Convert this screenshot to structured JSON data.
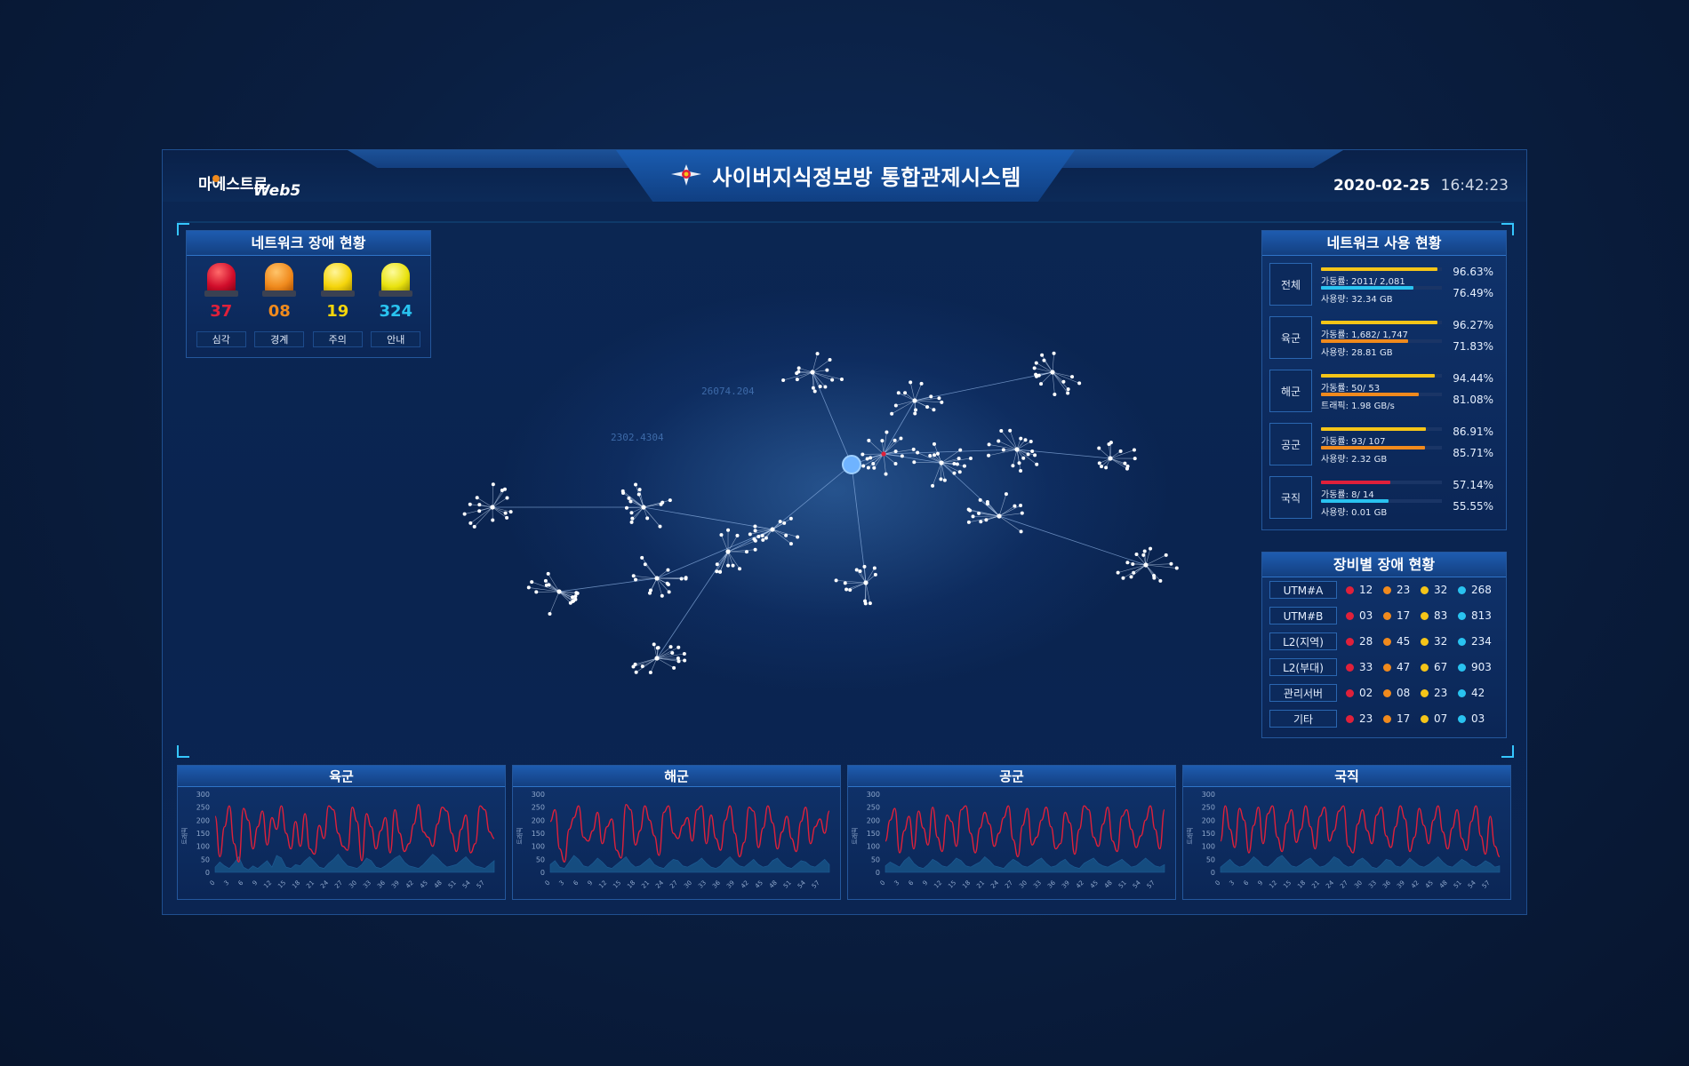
{
  "header": {
    "logo_main": "마에스트로",
    "logo_sub": "Web5",
    "title": "사이버지식정보방 통합관제시스템",
    "date": "2020-02-25",
    "time": "16:42:23"
  },
  "alarm_panel": {
    "title": "네트워크 장애 현황",
    "items": [
      {
        "label": "심각",
        "count": "37",
        "color": "#e0203a"
      },
      {
        "label": "경계",
        "count": "08",
        "color": "#f08a1d"
      },
      {
        "label": "주의",
        "count": "19",
        "color": "#f5d50b"
      },
      {
        "label": "안내",
        "count": "324",
        "color": "#29c3f0"
      }
    ]
  },
  "usage_panel": {
    "title": "네트워크 사용 현황",
    "rows": [
      {
        "category": "전체",
        "line1": "가동률: 2011/ 2,081",
        "pct1": "96.63%",
        "line2": "사용량: 32.34 GB",
        "pct2": "76.49%",
        "fill1": 0.9663,
        "fill2": 0.7649,
        "color1": "#f5c518",
        "color2": "#29c3f0"
      },
      {
        "category": "육군",
        "line1": "가동률: 1,682/ 1,747",
        "pct1": "96.27%",
        "line2": "사용량: 28.81 GB",
        "pct2": "71.83%",
        "fill1": 0.9627,
        "fill2": 0.7183,
        "color1": "#f5c518",
        "color2": "#f08a1d"
      },
      {
        "category": "해군",
        "line1": "가동률: 50/ 53",
        "pct1": "94.44%",
        "line2": "트래픽: 1.98 GB/s",
        "pct2": "81.08%",
        "fill1": 0.9444,
        "fill2": 0.8108,
        "color1": "#f5c518",
        "color2": "#f08a1d"
      },
      {
        "category": "공군",
        "line1": "가동률: 93/ 107",
        "pct1": "86.91%",
        "line2": "사용량: 2.32 GB",
        "pct2": "85.71%",
        "fill1": 0.8691,
        "fill2": 0.8571,
        "color1": "#f5c518",
        "color2": "#f08a1d"
      },
      {
        "category": "국직",
        "line1": "가동률: 8/ 14",
        "pct1": "57.14%",
        "line2": "사용량: 0.01 GB",
        "pct2": "55.55%",
        "fill1": 0.5714,
        "fill2": 0.5555,
        "color1": "#e0203a",
        "color2": "#29c3f0"
      }
    ]
  },
  "equip_panel": {
    "title": "장비별 장애 현황",
    "status_colors": [
      "#e0203a",
      "#f08a1d",
      "#f5c518",
      "#29c3f0"
    ],
    "rows": [
      {
        "name": "UTM#A",
        "values": [
          "12",
          "23",
          "32",
          "268"
        ]
      },
      {
        "name": "UTM#B",
        "values": [
          "03",
          "17",
          "83",
          "813"
        ]
      },
      {
        "name": "L2(지역)",
        "values": [
          "28",
          "45",
          "32",
          "234"
        ]
      },
      {
        "name": "L2(부대)",
        "values": [
          "33",
          "47",
          "67",
          "903"
        ]
      },
      {
        "name": "관리서버",
        "values": [
          "02",
          "08",
          "23",
          "42"
        ]
      },
      {
        "name": "기타",
        "values": [
          "23",
          "17",
          "07",
          "03"
        ]
      }
    ]
  },
  "bg_text": [
    "26074.204",
    "2302.4304"
  ],
  "chart_data": [
    {
      "type": "line",
      "title": "육군",
      "ylabel": "트래픽",
      "y_ticks": [
        0,
        50,
        100,
        150,
        200,
        250,
        300
      ],
      "x_ticks": [
        0,
        3,
        6,
        9,
        12,
        15,
        18,
        21,
        24,
        27,
        30,
        33,
        36,
        39,
        42,
        45,
        48,
        51,
        54,
        57
      ],
      "ylim": [
        0,
        300
      ],
      "series": [
        {
          "color": "#e0203a",
          "values": [
            215,
            60,
            175,
            255,
            110,
            40,
            245,
            200,
            90,
            175,
            235,
            105,
            210,
            165,
            255,
            150,
            90,
            195,
            100,
            225,
            90,
            70,
            180,
            130,
            255,
            240,
            150,
            100,
            85,
            250,
            195,
            45,
            225,
            175,
            90,
            160,
            210,
            75,
            240,
            150,
            80,
            110,
            185,
            260,
            155,
            135,
            100,
            185,
            250,
            235,
            150,
            80,
            165,
            220,
            75,
            110,
            255,
            240,
            155,
            130
          ]
        },
        {
          "color": "#1e6a9e",
          "values": [
            20,
            40,
            25,
            15,
            35,
            60,
            20,
            10,
            25,
            15,
            30,
            45,
            20,
            65,
            55,
            20,
            15,
            30,
            25,
            45,
            60,
            40,
            20,
            15,
            35,
            50,
            70,
            45,
            25,
            20,
            15,
            30,
            55,
            45,
            20,
            15,
            25,
            40,
            55,
            65,
            40,
            25,
            20,
            15,
            30,
            50,
            70,
            55,
            35,
            20,
            25,
            30,
            45,
            60,
            40,
            25,
            20,
            15,
            30,
            45
          ]
        }
      ]
    },
    {
      "type": "line",
      "title": "해군",
      "ylabel": "트래픽",
      "y_ticks": [
        0,
        50,
        100,
        150,
        200,
        250,
        300
      ],
      "x_ticks": [
        0,
        3,
        6,
        9,
        12,
        15,
        18,
        21,
        24,
        27,
        30,
        33,
        36,
        39,
        42,
        45,
        48,
        51,
        54,
        57
      ],
      "ylim": [
        0,
        300
      ],
      "series": [
        {
          "color": "#e0203a",
          "values": [
            195,
            240,
            90,
            40,
            165,
            210,
            255,
            135,
            120,
            160,
            230,
            110,
            175,
            205,
            85,
            55,
            260,
            240,
            105,
            160,
            255,
            200,
            140,
            65,
            230,
            255,
            150,
            130,
            180,
            210,
            120,
            240,
            255,
            110,
            220,
            130,
            85,
            200,
            255,
            150,
            60,
            115,
            250,
            235,
            95,
            170,
            255,
            190,
            90,
            155,
            215,
            130,
            80,
            195,
            250,
            110,
            175,
            205,
            150,
            235
          ]
        },
        {
          "color": "#1e6a9e",
          "values": [
            30,
            45,
            20,
            15,
            40,
            65,
            50,
            25,
            20,
            35,
            55,
            40,
            20,
            15,
            30,
            45,
            60,
            35,
            20,
            25,
            40,
            55,
            30,
            20,
            15,
            35,
            50,
            45,
            25,
            20,
            30,
            40,
            55,
            35,
            20,
            15,
            25,
            45,
            60,
            40,
            25,
            20,
            35,
            50,
            30,
            20,
            25,
            45,
            55,
            35,
            20,
            15,
            30,
            45,
            40,
            25,
            20,
            35,
            50,
            30
          ]
        }
      ]
    },
    {
      "type": "line",
      "title": "공군",
      "ylabel": "트래픽",
      "y_ticks": [
        0,
        50,
        100,
        150,
        200,
        250,
        300
      ],
      "x_ticks": [
        0,
        3,
        6,
        9,
        12,
        15,
        18,
        21,
        24,
        27,
        30,
        33,
        36,
        39,
        42,
        45,
        48,
        51,
        54,
        57
      ],
      "ylim": [
        0,
        300
      ],
      "series": [
        {
          "color": "#e0203a",
          "values": [
            120,
            200,
            245,
            75,
            160,
            215,
            90,
            235,
            170,
            105,
            250,
            135,
            80,
            220,
            195,
            100,
            240,
            255,
            150,
            75,
            170,
            230,
            185,
            100,
            150,
            210,
            255,
            125,
            60,
            180,
            245,
            105,
            135,
            200,
            250,
            175,
            90,
            110,
            230,
            190,
            70,
            165,
            255,
            240,
            135,
            100,
            185,
            250,
            120,
            80,
            215,
            240,
            165,
            95,
            140,
            200,
            255,
            165,
            90,
            240
          ]
        },
        {
          "color": "#1e6a9e",
          "values": [
            25,
            40,
            30,
            20,
            45,
            60,
            35,
            20,
            15,
            30,
            50,
            40,
            25,
            20,
            35,
            55,
            45,
            25,
            20,
            30,
            40,
            60,
            45,
            25,
            20,
            15,
            35,
            50,
            40,
            25,
            20,
            30,
            45,
            55,
            35,
            20,
            25,
            40,
            50,
            30,
            20,
            15,
            35,
            45,
            55,
            35,
            25,
            20,
            30,
            40,
            50,
            35,
            20,
            25,
            40,
            55,
            40,
            25,
            20,
            30
          ]
        }
      ]
    },
    {
      "type": "line",
      "title": "국직",
      "ylabel": "트래픽",
      "y_ticks": [
        0,
        50,
        100,
        150,
        200,
        250,
        300
      ],
      "x_ticks": [
        0,
        3,
        6,
        9,
        12,
        15,
        18,
        21,
        24,
        27,
        30,
        33,
        36,
        39,
        42,
        45,
        48,
        51,
        54,
        57
      ],
      "ylim": [
        0,
        300
      ],
      "series": [
        {
          "color": "#e0203a",
          "values": [
            120,
            255,
            165,
            95,
            245,
            200,
            75,
            180,
            250,
            110,
            225,
            255,
            135,
            80,
            190,
            240,
            115,
            165,
            255,
            175,
            90,
            215,
            250,
            120,
            160,
            235,
            255,
            100,
            75,
            185,
            240,
            160,
            110,
            220,
            250,
            140,
            95,
            175,
            255,
            205,
            80,
            135,
            245,
            180,
            110,
            200,
            255,
            155,
            90,
            170,
            240,
            130,
            85,
            195,
            255,
            140,
            70,
            215,
            100,
            60
          ]
        },
        {
          "color": "#1e6a9e",
          "values": [
            20,
            35,
            50,
            30,
            20,
            25,
            40,
            60,
            45,
            25,
            20,
            35,
            55,
            65,
            45,
            25,
            20,
            30,
            45,
            55,
            35,
            20,
            25,
            40,
            60,
            50,
            30,
            20,
            25,
            45,
            55,
            40,
            20,
            15,
            30,
            50,
            45,
            25,
            20,
            35,
            55,
            40,
            25,
            20,
            30,
            45,
            60,
            40,
            25,
            20,
            35,
            50,
            40,
            25,
            20,
            30,
            45,
            35,
            20,
            25
          ]
        }
      ]
    }
  ]
}
